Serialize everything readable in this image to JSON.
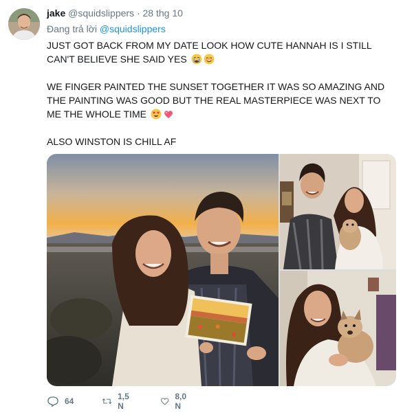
{
  "author": {
    "name": "jake",
    "handle": "@squidslippers",
    "separator": "·",
    "date": "28 thg 10"
  },
  "reply_to": {
    "prefix": "Đang trả lời",
    "mention": "@squidslippers"
  },
  "tweet": {
    "paragraph1": "JUST GOT BACK FROM MY DATE LOOK HOW CUTE HANNAH IS I STILL CAN'T BELIEVE SHE SAID YES",
    "paragraph2": "WE FINGER PAINTED THE SUNSET TOGETHER IT WAS SO AMAZING AND THE PAINTING WAS GOOD BUT THE REAL MASTERPIECE WAS NEXT TO ME THE WHOLE TIME",
    "paragraph3": "ALSO WINSTON IS CHILL AF",
    "emojis1": [
      "crying-face",
      "smiling-face-with-smiling-eyes"
    ],
    "emojis2": [
      "heart-eyes-face",
      "sparkling-heart"
    ]
  },
  "media": {
    "photos": [
      "couple-with-painting-at-sunset",
      "couple-with-puppy-indoors",
      "woman-with-puppy"
    ]
  },
  "actions": {
    "reply_count": "64",
    "retweet_count": "1,5 N",
    "like_count": "8,0 N",
    "reply_icon": "speech-bubble-icon",
    "retweet_icon": "retweet-icon",
    "like_icon": "heart-icon"
  },
  "colors": {
    "link": "#1b95e0",
    "secondary": "#657786",
    "text": "#14171a"
  }
}
